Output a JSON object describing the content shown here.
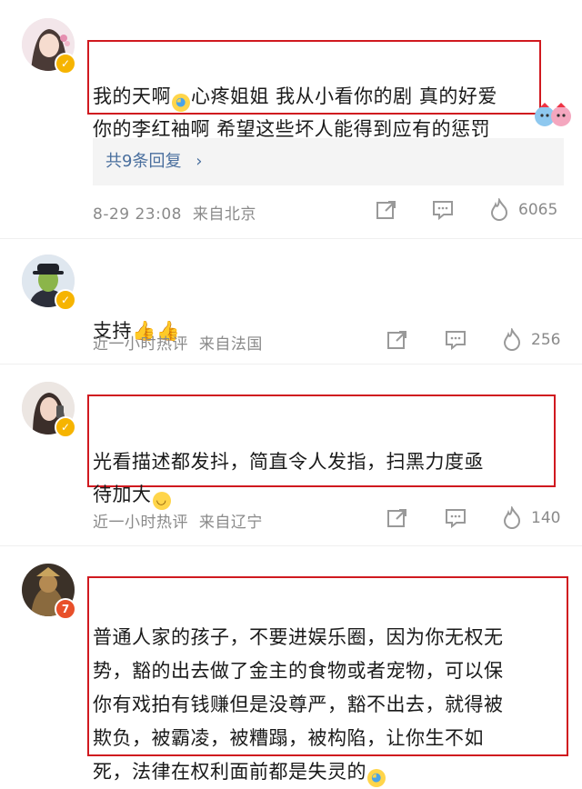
{
  "comments": [
    {
      "text_before": "我的天啊",
      "text_after": "心疼姐姐 我从小看你的剧 真的好爱\n你的李红袖啊 希望这些坏人能得到应有的惩罚",
      "reply_label": "共9条回复",
      "time": "8-29 23:08",
      "location": "来自北京",
      "likes": "6065",
      "avatar_icon": "girl-avatar-icon"
    },
    {
      "text_before": "支持",
      "text_after": "",
      "time": "近一小时热评",
      "location": "来自法国",
      "likes": "256",
      "avatar_icon": "bowler-hat-avatar-icon"
    },
    {
      "text_before": "光看描述都发抖，简直令人发指，扫黑力度亟\n待加大",
      "text_after": "",
      "time": "近一小时热评",
      "location": "来自辽宁",
      "likes": "140",
      "avatar_icon": "woman-avatar-icon"
    },
    {
      "text_before": "普通人家的孩子，不要进娱乐圈，因为你无权无\n势，豁的出去做了金主的食物或者宠物，可以保\n你有戏拍有钱赚但是没尊严，豁不出去，就得被\n欺负，被霸凌，被糟蹋，被构陷，让你生不如\n死，法律在权利面前都是失灵的",
      "text_after": "",
      "avatar_icon": "statue-avatar-icon",
      "badge": "7"
    }
  ],
  "colors": {
    "highlight": "#d0191f",
    "link": "#4a6f9e",
    "meta": "#8a8a8a",
    "badge": "#f6b400"
  }
}
